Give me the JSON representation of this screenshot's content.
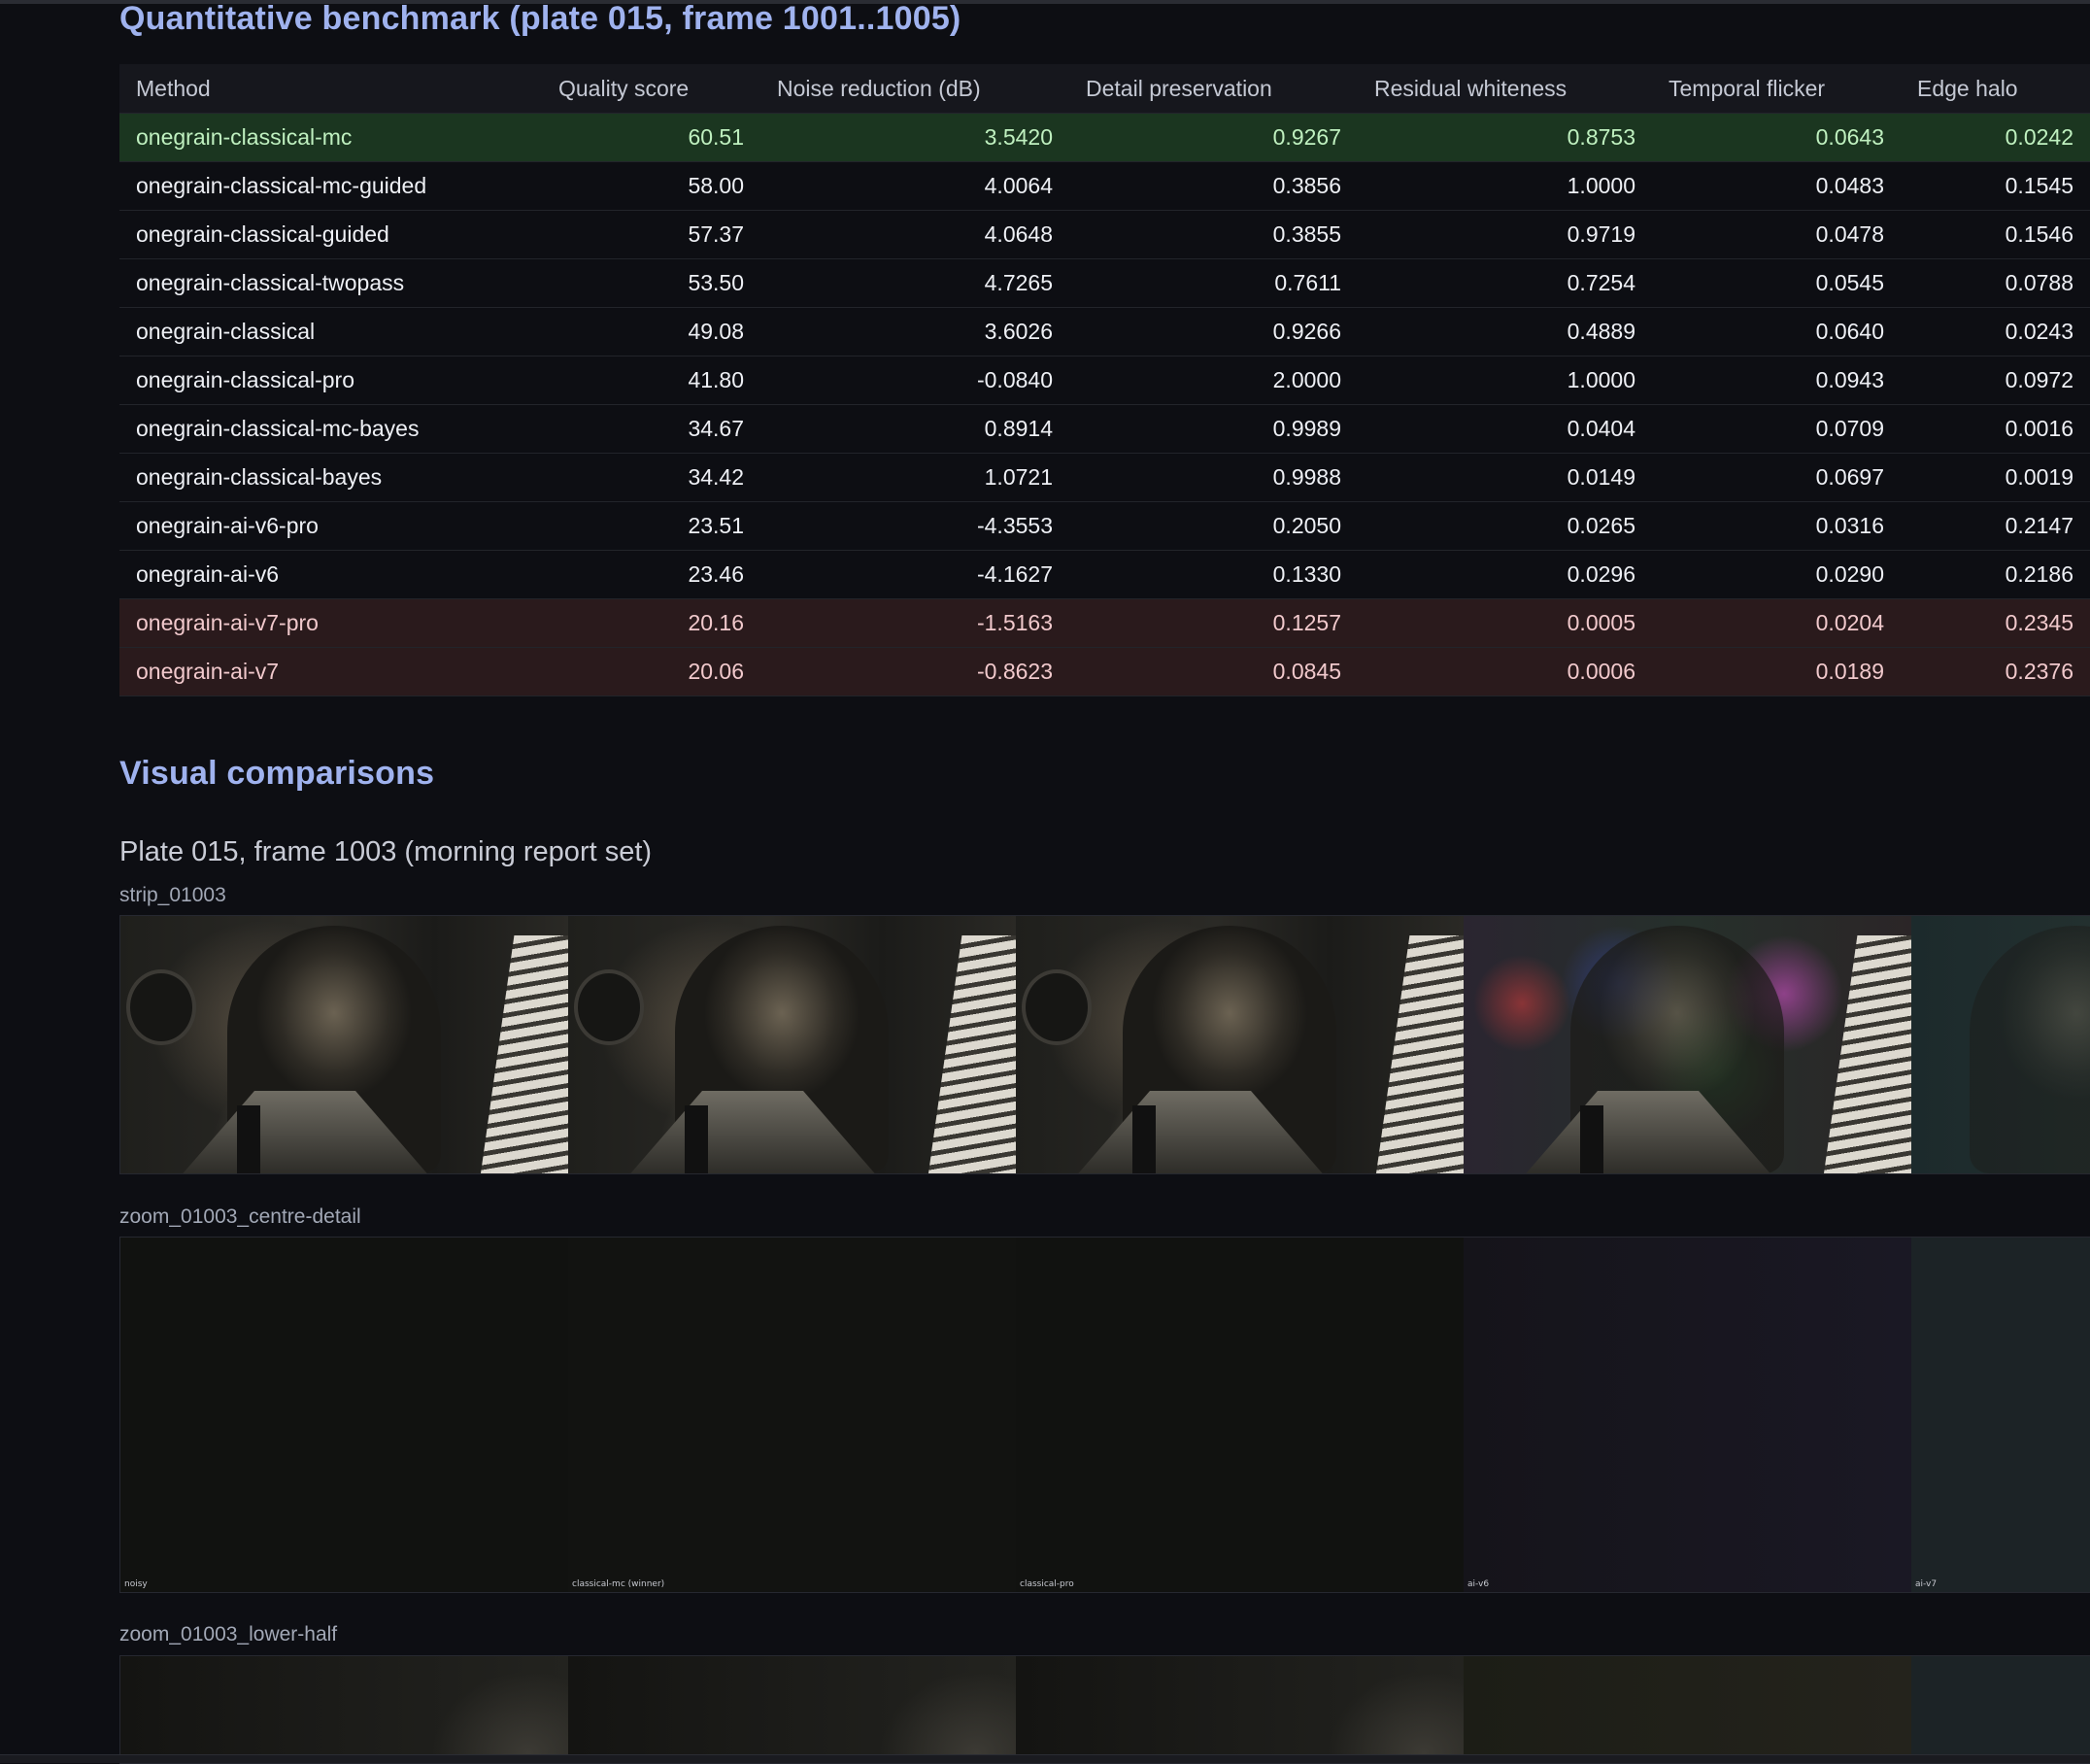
{
  "benchmark": {
    "title": "Quantitative benchmark (plate 015, frame 1001..1005)",
    "columns": [
      "Method",
      "Quality score",
      "Noise reduction (dB)",
      "Detail preservation",
      "Residual whiteness",
      "Temporal flicker",
      "Edge halo"
    ],
    "rows": [
      {
        "method": "onegrain-classical-mc",
        "quality": "60.51",
        "noise": "3.5420",
        "detail": "0.9267",
        "whiteness": "0.8753",
        "flicker": "0.0643",
        "halo": "0.0242"
      },
      {
        "method": "onegrain-classical-mc-guided",
        "quality": "58.00",
        "noise": "4.0064",
        "detail": "0.3856",
        "whiteness": "1.0000",
        "flicker": "0.0483",
        "halo": "0.1545"
      },
      {
        "method": "onegrain-classical-guided",
        "quality": "57.37",
        "noise": "4.0648",
        "detail": "0.3855",
        "whiteness": "0.9719",
        "flicker": "0.0478",
        "halo": "0.1546"
      },
      {
        "method": "onegrain-classical-twopass",
        "quality": "53.50",
        "noise": "4.7265",
        "detail": "0.7611",
        "whiteness": "0.7254",
        "flicker": "0.0545",
        "halo": "0.0788"
      },
      {
        "method": "onegrain-classical",
        "quality": "49.08",
        "noise": "3.6026",
        "detail": "0.9266",
        "whiteness": "0.4889",
        "flicker": "0.0640",
        "halo": "0.0243"
      },
      {
        "method": "onegrain-classical-pro",
        "quality": "41.80",
        "noise": "-0.0840",
        "detail": "2.0000",
        "whiteness": "1.0000",
        "flicker": "0.0943",
        "halo": "0.0972"
      },
      {
        "method": "onegrain-classical-mc-bayes",
        "quality": "34.67",
        "noise": "0.8914",
        "detail": "0.9989",
        "whiteness": "0.0404",
        "flicker": "0.0709",
        "halo": "0.0016"
      },
      {
        "method": "onegrain-classical-bayes",
        "quality": "34.42",
        "noise": "1.0721",
        "detail": "0.9988",
        "whiteness": "0.0149",
        "flicker": "0.0697",
        "halo": "0.0019"
      },
      {
        "method": "onegrain-ai-v6-pro",
        "quality": "23.51",
        "noise": "-4.3553",
        "detail": "0.2050",
        "whiteness": "0.0265",
        "flicker": "0.0316",
        "halo": "0.2147"
      },
      {
        "method": "onegrain-ai-v6",
        "quality": "23.46",
        "noise": "-4.1627",
        "detail": "0.1330",
        "whiteness": "0.0296",
        "flicker": "0.0290",
        "halo": "0.2186"
      },
      {
        "method": "onegrain-ai-v7-pro",
        "quality": "20.16",
        "noise": "-1.5163",
        "detail": "0.1257",
        "whiteness": "0.0005",
        "flicker": "0.0204",
        "halo": "0.2345"
      },
      {
        "method": "onegrain-ai-v7",
        "quality": "20.06",
        "noise": "-0.8623",
        "detail": "0.0845",
        "whiteness": "0.0006",
        "flicker": "0.0189",
        "halo": "0.2376"
      }
    ],
    "row_status": [
      "winner",
      "normal",
      "normal",
      "normal",
      "normal",
      "normal",
      "normal",
      "normal",
      "normal",
      "normal",
      "loser",
      "loser"
    ]
  },
  "visual": {
    "title": "Visual comparisons",
    "subtitle": "Plate 015, frame 1003 (morning report set)",
    "strip_label": "strip_01003",
    "zoom1_label": "zoom_01003_centre-detail",
    "zoom2_label": "zoom_01003_lower-half",
    "zoom1_captions": [
      "noisy",
      "classical-mc (winner)",
      "classical-pro",
      "ai-v6",
      "ai-v7"
    ]
  },
  "colors": {
    "page_bg": "#0d0e13",
    "heading": "#9fb2ee",
    "winner_row": "#1b3620",
    "loser_row": "#2a1a1c"
  }
}
